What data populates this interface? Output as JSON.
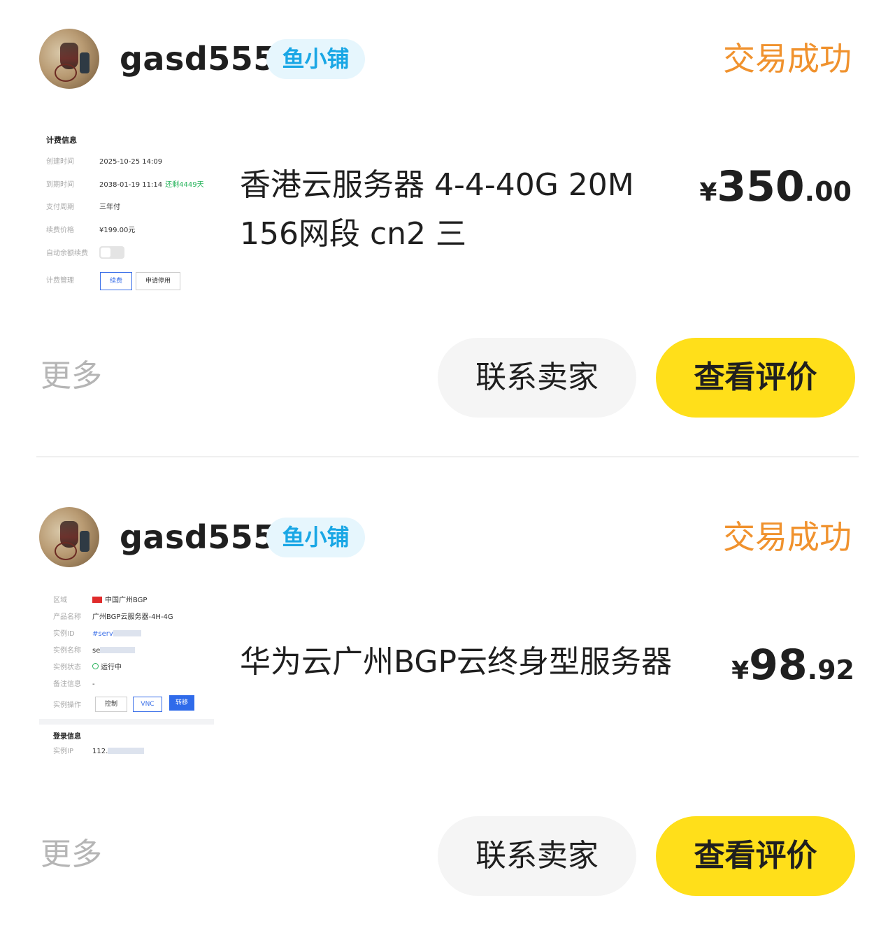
{
  "orders": [
    {
      "seller_name": "gasd555",
      "shop_badge": "鱼小铺",
      "status": "交易成功",
      "title": "香港云服务器 4-4-40G 20M 156网段 cn2 三",
      "price": {
        "currency": "¥",
        "integer": "350",
        "decimal": ".00"
      },
      "thumbnail": {
        "heading": "计费信息",
        "rows": [
          {
            "label": "创建时间",
            "value": "2025-10-25 14:09"
          },
          {
            "label": "到期时间",
            "value": "2038-01-19 11:14",
            "note": "还剩4449天"
          },
          {
            "label": "支付周期",
            "value": "三年付"
          },
          {
            "label": "续费价格",
            "value": "¥199.00元"
          },
          {
            "label": "自动余额续费",
            "value": ""
          },
          {
            "label": "计费管理",
            "value": ""
          }
        ],
        "buttons": [
          "续费",
          "申请停用"
        ]
      },
      "more_label": "更多",
      "contact_label": "联系卖家",
      "review_label": "查看评价"
    },
    {
      "seller_name": "gasd555",
      "shop_badge": "鱼小铺",
      "status": "交易成功",
      "title": "华为云广州BGP云终身型服务器",
      "price": {
        "currency": "¥",
        "integer": "98",
        "decimal": ".92"
      },
      "thumbnail": {
        "rows": [
          {
            "label": "区域",
            "value": "中国广州BGP"
          },
          {
            "label": "产品名称",
            "value": "广州BGP云服务器-4H-4G"
          },
          {
            "label": "实例ID",
            "value": "#serv"
          },
          {
            "label": "实例名称",
            "value": "se"
          },
          {
            "label": "实例状态",
            "value": "运行中"
          },
          {
            "label": "备注信息",
            "value": "-"
          },
          {
            "label": "实例操作",
            "value": ""
          }
        ],
        "buttons": [
          "控制",
          "VNC",
          "转移"
        ],
        "section2": "登录信息",
        "ip_label": "实例IP",
        "ip_value": "112."
      },
      "more_label": "更多",
      "contact_label": "联系卖家",
      "review_label": "查看评价"
    }
  ]
}
